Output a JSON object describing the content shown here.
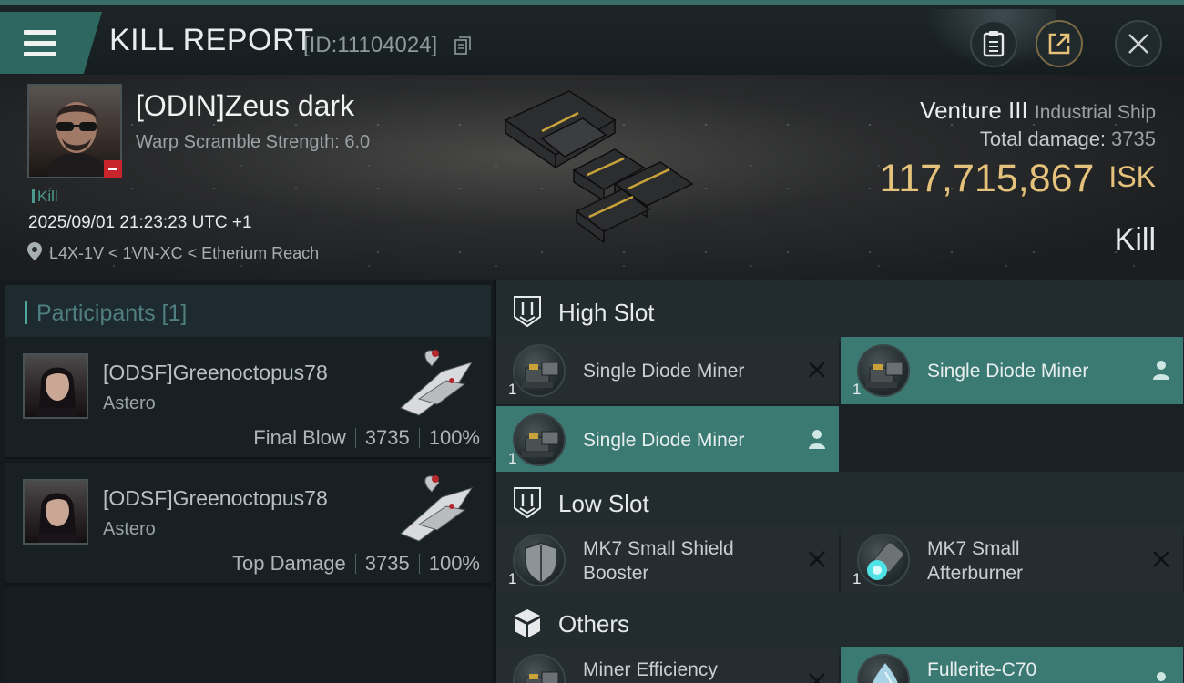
{
  "header": {
    "title": "KILL REPORT",
    "report_id": "[ID:11104024]"
  },
  "victim": {
    "name": "[ODIN]Zeus dark",
    "warp_scramble": "Warp Scramble Strength: 6.0",
    "tag": "Kill",
    "datetime": "2025/09/01 21:23:23 UTC +1",
    "location": "L4X-1V < 1VN-XC < Etherium Reach",
    "ship_name": "Venture III",
    "ship_class": "Industrial Ship",
    "total_damage_label": "Total damage:",
    "total_damage": "3735",
    "isk_value": "117,715,867",
    "isk_unit": "ISK",
    "result": "Kill"
  },
  "participants": {
    "title": "Participants [1]",
    "rows": [
      {
        "name": "[ODSF]Greenoctopus78",
        "ship": "Astero",
        "role": "Final Blow",
        "damage": "3735",
        "percent": "100%"
      },
      {
        "name": "[ODSF]Greenoctopus78",
        "ship": "Astero",
        "role": "Top Damage",
        "damage": "3735",
        "percent": "100%"
      }
    ]
  },
  "fitting": {
    "high_slot": {
      "title": "High Slot",
      "items": [
        {
          "name": "Single Diode Miner",
          "qty": "1",
          "status": "destroyed"
        },
        {
          "name": "Single Diode Miner",
          "qty": "1",
          "status": "dropped"
        },
        {
          "name": "Single Diode Miner",
          "qty": "1",
          "status": "dropped"
        }
      ]
    },
    "low_slot": {
      "title": "Low Slot",
      "items": [
        {
          "name": "MK7 Small Shield Booster",
          "name_l1": "MK7 Small Shield",
          "name_l2": "Booster",
          "qty": "1",
          "status": "destroyed"
        },
        {
          "name": "MK7 Small Afterburner",
          "name_l1": "MK7 Small",
          "name_l2": "Afterburner",
          "qty": "1",
          "status": "destroyed"
        }
      ]
    },
    "others": {
      "title": "Others",
      "items": [
        {
          "name": "Miner Efficiency",
          "status": "destroyed"
        },
        {
          "name": "Fullerite-C70",
          "status": "dropped"
        }
      ]
    }
  },
  "colors": {
    "accent": "#3a7a73",
    "isk": "#e4c27c",
    "security_badge": "#c8242b"
  }
}
